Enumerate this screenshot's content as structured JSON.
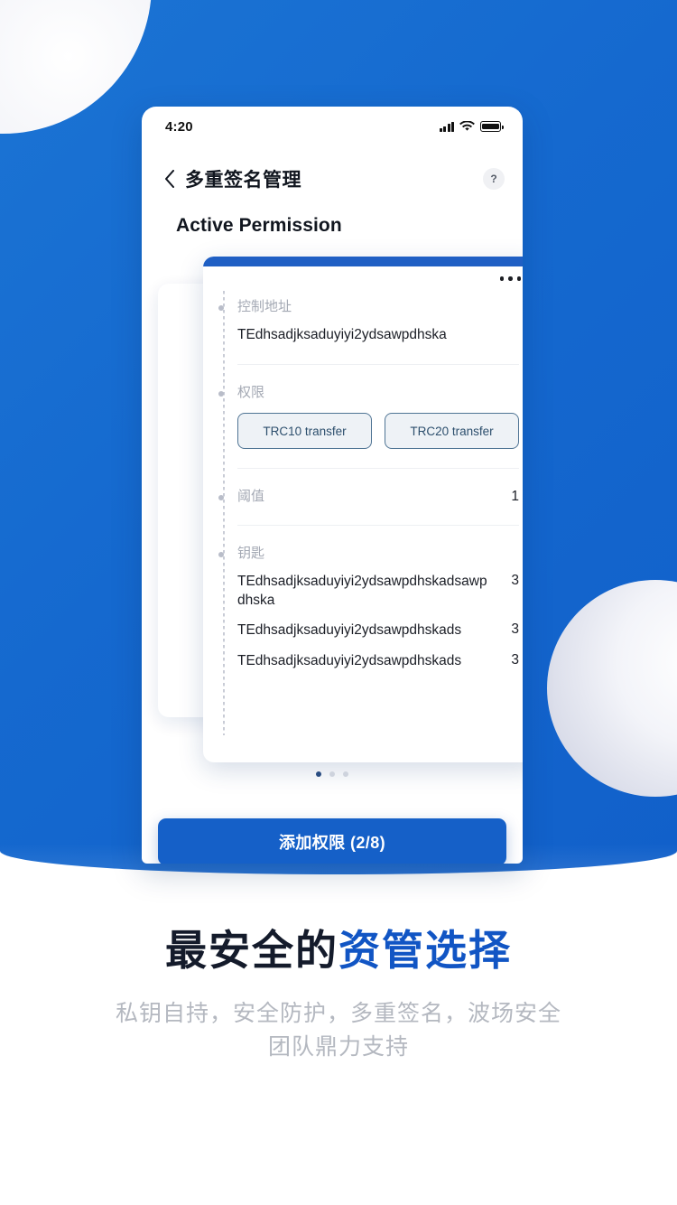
{
  "background": {
    "hero_color_start": "#1b74d4",
    "hero_color_end": "#1160ca"
  },
  "phone": {
    "status_bar": {
      "time": "4:20",
      "signal_icon": "cellular-signal-icon",
      "wifi_icon": "wifi-icon",
      "battery_icon": "battery-full-icon"
    },
    "nav": {
      "back_icon": "chevron-left-icon",
      "title": "多重签名管理",
      "help_label": "?"
    },
    "section_title": "Active Permission",
    "card": {
      "menu_icon": "more-horizontal-icon",
      "control_address": {
        "label": "控制地址",
        "value": "TEdhsadjksaduyiyi2ydsawpdhska"
      },
      "permissions": {
        "label": "权限",
        "chips": [
          "TRC10 transfer",
          "TRC20 transfer"
        ]
      },
      "threshold": {
        "label": "阈值",
        "value": "1"
      },
      "keys": {
        "label": "钥匙",
        "items": [
          {
            "address": "TEdhsadjksaduyiyi2ydsawpdhskadsawpdhska",
            "weight": "3"
          },
          {
            "address": "TEdhsadjksaduyiyi2ydsawpdhskads",
            "weight": "3"
          },
          {
            "address": "TEdhsadjksaduyiyi2ydsawpdhskads",
            "weight": "3"
          }
        ]
      }
    },
    "pagination": {
      "total": 3,
      "active_index": 0
    },
    "primary_button": "添加权限 (2/8)"
  },
  "promo": {
    "headline_prefix": "最安全的",
    "headline_accent": "资管选择",
    "accent_color": "#1155c4",
    "subtitle": "私钥自持，安全防护，多重签名，波场安全团队鼎力支持"
  }
}
